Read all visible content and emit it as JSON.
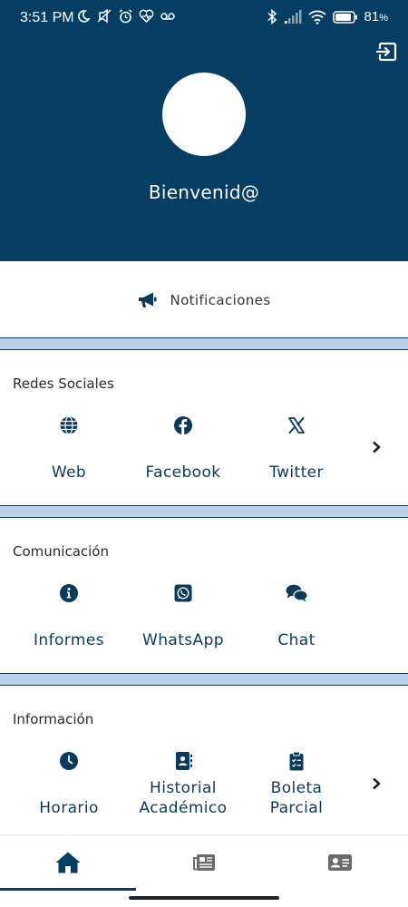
{
  "status_bar": {
    "time": "3:51 PM",
    "battery": "81",
    "battery_unit": "%",
    "icons": [
      "moon-icon",
      "muted-icon",
      "alarm-icon",
      "heart-rate-icon",
      "voicemail-icon",
      "bluetooth-icon",
      "signal-icon",
      "wifi-icon",
      "battery-icon"
    ]
  },
  "header": {
    "welcome": "Bienvenid@",
    "logout_icon": "logout-icon",
    "background": "#063d63"
  },
  "notifications": {
    "label": "Notificaciones",
    "icon": "megaphone-icon"
  },
  "sections": [
    {
      "title": "Redes Sociales",
      "items": [
        {
          "label": "Web",
          "icon": "globe-icon"
        },
        {
          "label": "Facebook",
          "icon": "facebook-icon"
        },
        {
          "label": "Twitter",
          "icon": "x-icon"
        }
      ],
      "has_more": true
    },
    {
      "title": "Comunicación",
      "items": [
        {
          "label": "Informes",
          "icon": "info-icon"
        },
        {
          "label": "WhatsApp",
          "icon": "whatsapp-icon"
        },
        {
          "label": "Chat",
          "icon": "chat-icon"
        }
      ],
      "has_more": false
    },
    {
      "title": "Información",
      "items": [
        {
          "label": "Horario",
          "icon": "clock-icon"
        },
        {
          "label": "Historial Académico",
          "line1": "Historial",
          "line2": "Académico",
          "icon": "contact-book-icon"
        },
        {
          "label": "Boleta Parcial",
          "line1": "Boleta",
          "line2": "Parcial",
          "icon": "clipboard-icon"
        }
      ],
      "has_more": true
    }
  ],
  "bottom_nav": {
    "items": [
      {
        "icon": "home-icon",
        "active": true
      },
      {
        "icon": "newspaper-icon",
        "active": false
      },
      {
        "icon": "id-card-icon",
        "active": false
      }
    ]
  },
  "colors": {
    "primary": "#063d63",
    "divider": "#b9d0ec",
    "text": "#0b3a5b"
  }
}
